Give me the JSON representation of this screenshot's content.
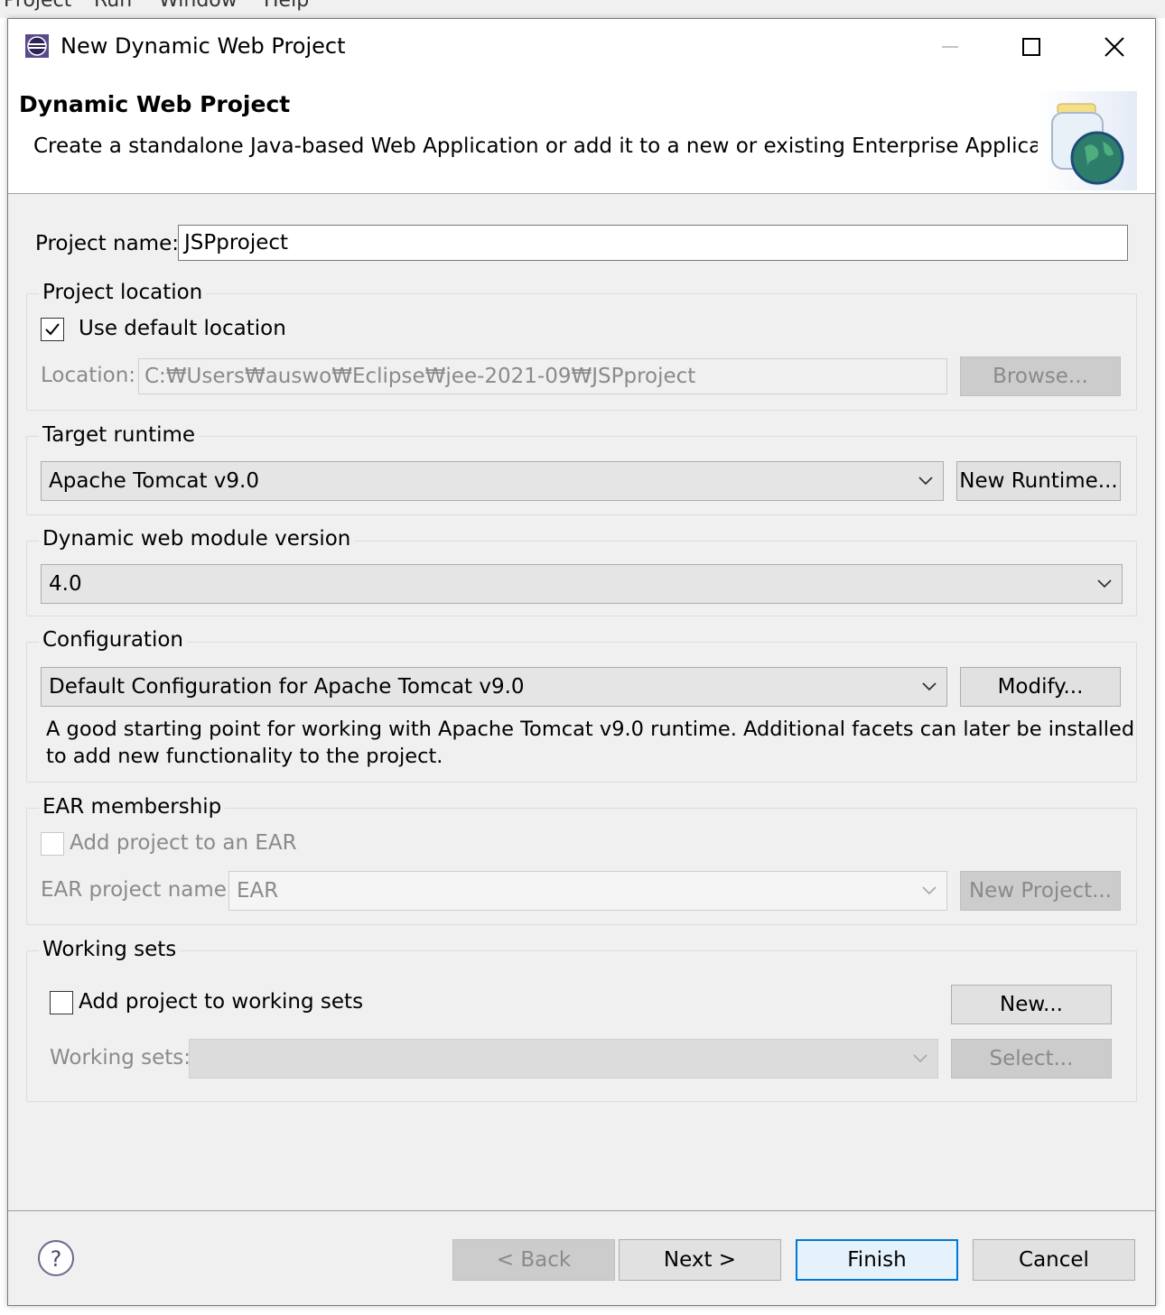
{
  "background_menu": [
    "Project",
    "Run",
    "Window",
    "Help"
  ],
  "window": {
    "title": "New Dynamic Web Project",
    "minimize_icon": "minimize-icon",
    "maximize_icon": "maximize-icon",
    "close_icon": "close-icon"
  },
  "header": {
    "title": "Dynamic Web Project",
    "description": "Create a standalone Java-based Web Application or add it to a new or existing Enterprise Application."
  },
  "project_name": {
    "label": "Project name:",
    "value": "JSPproject"
  },
  "project_location": {
    "group_title": "Project location",
    "use_default_label": "Use default location",
    "use_default_checked": true,
    "location_label": "Location:",
    "location_value": "C:\\Users\\auswo\\Eclipse\\jee-2021-09\\JSPproject",
    "location_display": "C:₩Users₩auswo₩Eclipse₩jee-2021-09₩JSPproject",
    "browse_label": "Browse..."
  },
  "target_runtime": {
    "group_title": "Target runtime",
    "selected": "Apache Tomcat v9.0",
    "new_runtime_label": "New Runtime..."
  },
  "module_version": {
    "group_title": "Dynamic web module version",
    "selected": "4.0"
  },
  "configuration": {
    "group_title": "Configuration",
    "selected": "Default Configuration for Apache Tomcat v9.0",
    "modify_label": "Modify...",
    "description_line1": "A good starting point for working with Apache Tomcat v9.0 runtime. Additional facets can later be installed",
    "description_line2": "to add new functionality to the project."
  },
  "ear_membership": {
    "group_title": "EAR membership",
    "add_label": "Add project to an EAR",
    "add_checked": false,
    "name_label": "EAR project name:",
    "name_value": "EAR",
    "new_project_label": "New Project..."
  },
  "working_sets": {
    "group_title": "Working sets",
    "add_label": "Add project to working sets",
    "add_checked": false,
    "new_label": "New...",
    "sets_label": "Working sets:",
    "sets_value": "",
    "select_label": "Select..."
  },
  "footer": {
    "back_label": "< Back",
    "next_label": "Next >",
    "finish_label": "Finish",
    "cancel_label": "Cancel",
    "help_icon": "help-icon"
  },
  "colors": {
    "default_button_border": "#0078d7",
    "dialog_background": "#f0f0f0"
  }
}
